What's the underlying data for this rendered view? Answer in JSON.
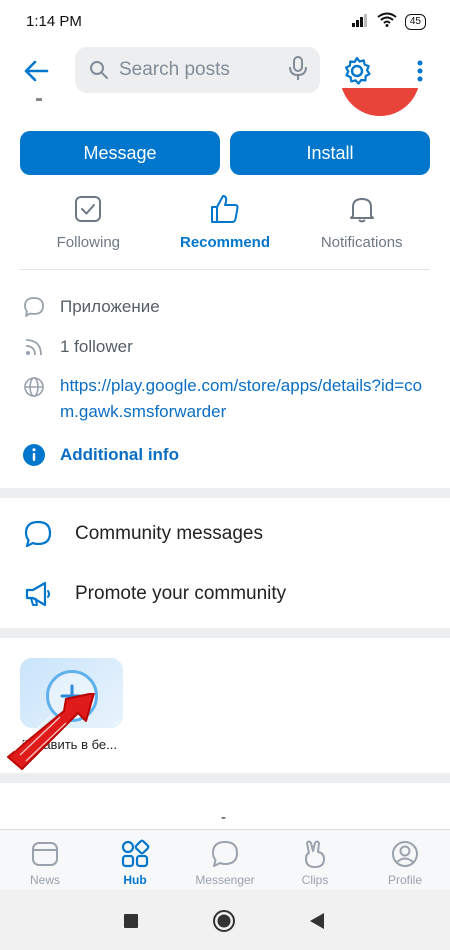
{
  "status": {
    "time": "1:14 PM",
    "battery": "45"
  },
  "search": {
    "placeholder": "Search posts"
  },
  "buttons": {
    "message": "Message",
    "install": "Install"
  },
  "actions": [
    {
      "label": "Following",
      "icon": "checkbox-icon",
      "active": false
    },
    {
      "label": "Recommend",
      "icon": "thumbs-up-icon",
      "active": true
    },
    {
      "label": "Notifications",
      "icon": "bell-icon",
      "active": false
    }
  ],
  "info": {
    "category": "Приложение",
    "followers": "1 follower",
    "link": "https://play.google.com/store/apps/details?id=com.gawk.smsforwarder",
    "additional": "Additional info"
  },
  "menu": {
    "community_messages": "Community messages",
    "promote": "Promote your community"
  },
  "app_tile": {
    "caption": "Добавить в бе..."
  },
  "footer_dash": "-",
  "tabs": [
    {
      "label": "News",
      "icon": "news-icon",
      "active": false
    },
    {
      "label": "Hub",
      "icon": "hub-icon",
      "active": true
    },
    {
      "label": "Messenger",
      "icon": "messenger-icon",
      "active": false
    },
    {
      "label": "Clips",
      "icon": "clips-icon",
      "active": false
    },
    {
      "label": "Profile",
      "icon": "profile-icon",
      "active": false
    }
  ],
  "colors": {
    "accent": "#0077cc",
    "link": "#0a6ec4",
    "avatar": "#e8443a",
    "arrow": "#e01b1b"
  }
}
